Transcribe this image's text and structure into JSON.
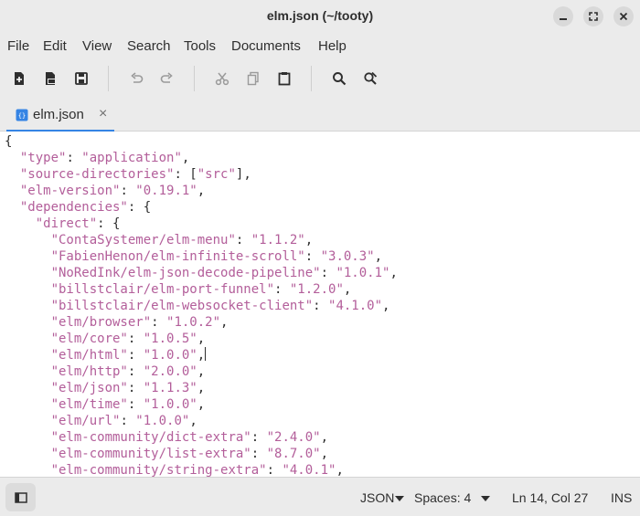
{
  "window": {
    "title": "elm.json (~/tooty)"
  },
  "menubar": {
    "items": [
      "File",
      "Edit",
      "View",
      "Search",
      "Tools",
      "Documents",
      "Help"
    ]
  },
  "toolbar": {
    "buttons": [
      {
        "name": "new-document",
        "icon": "new-document-icon"
      },
      {
        "name": "open",
        "icon": "open-icon"
      },
      {
        "name": "save",
        "icon": "save-icon"
      },
      {
        "name": "undo",
        "icon": "undo-icon"
      },
      {
        "name": "redo",
        "icon": "redo-icon"
      },
      {
        "name": "cut",
        "icon": "cut-icon"
      },
      {
        "name": "copy",
        "icon": "copy-icon"
      },
      {
        "name": "paste",
        "icon": "paste-icon"
      },
      {
        "name": "search",
        "icon": "search-icon"
      },
      {
        "name": "search-replace",
        "icon": "search-replace-icon"
      }
    ]
  },
  "tab": {
    "label": "elm.json",
    "close": "×"
  },
  "editor": {
    "lines": [
      "{",
      "  \"type\": \"application\",",
      "  \"source-directories\": [\"src\"],",
      "  \"elm-version\": \"0.19.1\",",
      "  \"dependencies\": {",
      "    \"direct\": {",
      "      \"ContaSystemer/elm-menu\": \"1.1.2\",",
      "      \"FabienHenon/elm-infinite-scroll\": \"3.0.3\",",
      "      \"NoRedInk/elm-json-decode-pipeline\": \"1.0.1\",",
      "      \"billstclair/elm-port-funnel\": \"1.2.0\",",
      "      \"billstclair/elm-websocket-client\": \"4.1.0\",",
      "      \"elm/browser\": \"1.0.2\",",
      "      \"elm/core\": \"1.0.5\",",
      "      \"elm/html\": \"1.0.0\",",
      "      \"elm/http\": \"2.0.0\",",
      "      \"elm/json\": \"1.1.3\",",
      "      \"elm/time\": \"1.0.0\",",
      "      \"elm/url\": \"1.0.0\",",
      "      \"elm-community/dict-extra\": \"2.4.0\",",
      "      \"elm-community/list-extra\": \"8.7.0\",",
      "      \"elm-community/string-extra\": \"4.0.1\","
    ],
    "cursor_line": 14
  },
  "statusbar": {
    "language": "JSON",
    "spaces": "Spaces: 4",
    "position": "Ln 14, Col 27",
    "mode": "INS"
  },
  "colors": {
    "string": "#b35e9a",
    "accent": "#3584e4",
    "chrome": "#ebebeb"
  }
}
